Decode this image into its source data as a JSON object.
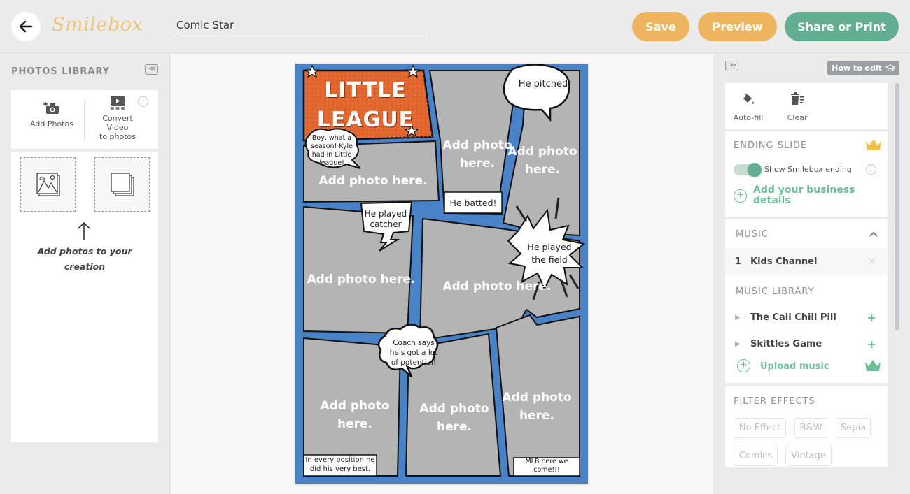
{
  "header": {
    "back_label": "Back",
    "logo": "Smilebox",
    "project_title": "Comic Star",
    "save_label": "Save",
    "preview_label": "Preview",
    "share_label": "Share or Print",
    "colors": {
      "save": "#edb55f",
      "preview": "#edb55f",
      "share": "#63ad92",
      "logo": "#ecc57a"
    }
  },
  "left_panel": {
    "title": "PHOTOS LIBRARY",
    "collapse_glyph": "<<",
    "add_photos_label": "Add Photos",
    "convert_video_label_1": "Convert",
    "convert_video_label_2": "Video",
    "convert_video_label_3": "to photos",
    "info_glyph": "i",
    "hint_line_1": "Add photos to your",
    "hint_line_2": "creation"
  },
  "comic": {
    "title_line_1": "LITTLE",
    "title_line_2": "LEAGUE",
    "photo_placeholder": "Add photo here.",
    "photo_placeholder_line_1": "Add photo",
    "photo_placeholder_line_2": "here.",
    "bubbles": {
      "season_1": "Boy, what a",
      "season_2": "season! Kyle",
      "season_3": "had in Little",
      "season_4": "league!",
      "pitched": "He pitched",
      "batted": "He batted!",
      "catcher_1": "He played",
      "catcher_2": "catcher",
      "field_1": "He played",
      "field_2": "the field",
      "coach_1": "Coach says",
      "coach_2": "he's got a lot",
      "coach_3": "of potential!",
      "position_1": "In every position he",
      "position_2": "did his very best.",
      "mlb_1": "MLB here we",
      "mlb_2": "come!!!"
    },
    "colors": {
      "border": "#4a82c8",
      "title_bg": "#e0642c",
      "panel": "#b4b4b4"
    }
  },
  "right_panel": {
    "expand_glyph": ">>",
    "how_to_edit": "How to edit",
    "autofill_label": "Auto-fill",
    "clear_label": "Clear",
    "ending_slide": {
      "title": "ENDING SLIDE",
      "toggle_label": "Show Smilebox ending",
      "toggle_on": true,
      "add_business_1": "Add your business",
      "add_business_2": "details"
    },
    "music": {
      "title": "MUSIC",
      "selected": [
        {
          "index": "1",
          "name": "Kids Channel"
        }
      ],
      "library_title": "MUSIC LIBRARY",
      "library": [
        {
          "name": "The Cali Chill Pill"
        },
        {
          "name": "Skittles Game"
        }
      ],
      "upload_label": "Upload music"
    },
    "filters": {
      "title": "FILTER EFFECTS",
      "options": [
        "No Effect",
        "B&W",
        "Sepia",
        "Comics",
        "Vintage"
      ]
    },
    "colors": {
      "accent_green": "#6fbf9c",
      "crown_gold": "#f0c04a",
      "crown_green": "#6fbf9c"
    }
  }
}
